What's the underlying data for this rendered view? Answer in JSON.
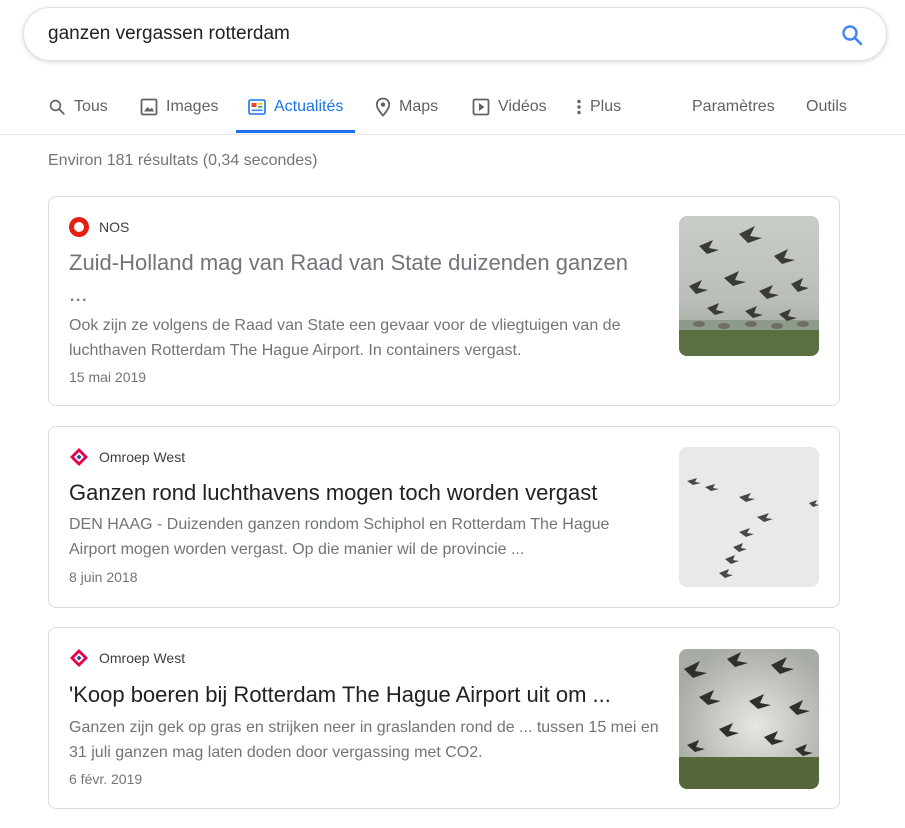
{
  "search": {
    "query": "ganzen vergassen rotterdam"
  },
  "tabs": [
    {
      "label": "Tous"
    },
    {
      "label": "Images"
    },
    {
      "label": "Actualités"
    },
    {
      "label": "Maps"
    },
    {
      "label": "Vidéos"
    },
    {
      "label": "Plus"
    }
  ],
  "tools": {
    "settings": "Paramètres",
    "tools": "Outils"
  },
  "results_stats": "Environ 181 résultats (0,34 secondes)",
  "results": [
    {
      "source": "NOS",
      "title": "Zuid-Holland mag van Raad van State duizenden ganzen ...",
      "snippet": "Ook zijn ze volgens de Raad van State een gevaar voor de vliegtuigen van de luchthaven Rotterdam The Hague Airport. In containers vergast.",
      "date": "15 mai 2019"
    },
    {
      "source": "Omroep West",
      "title": "Ganzen rond luchthavens mogen toch worden vergast",
      "snippet": "DEN HAAG - Duizenden ganzen rondom Schiphol en Rotterdam The Hague Airport mogen worden vergast. Op die manier wil de provincie ...",
      "date": "8 juin 2018"
    },
    {
      "source": "Omroep West",
      "title": "'Koop boeren bij Rotterdam The Hague Airport uit om ...",
      "snippet": "Ganzen zijn gek op gras en strijken neer in graslanden rond de ... tussen 15 mei en 31 juli ganzen mag laten doden door vergassing met CO2.",
      "date": "6 févr. 2019"
    }
  ],
  "colors": {
    "accent": "#1a73e8",
    "nos_red": "#e61e14",
    "omroep_red": "#e5004f",
    "omroep_blue": "#1f4e9c"
  }
}
